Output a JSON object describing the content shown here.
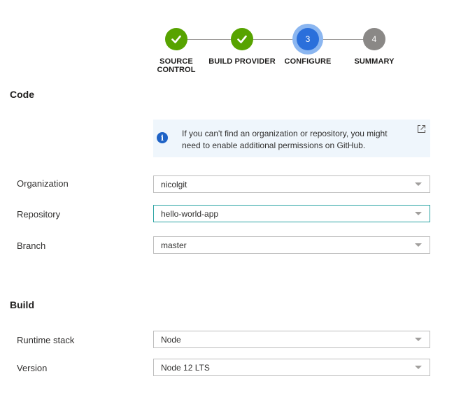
{
  "wizard": {
    "steps": [
      {
        "number": "1",
        "label": "Source control",
        "state": "done"
      },
      {
        "number": "2",
        "label": "Build provider",
        "state": "done"
      },
      {
        "number": "3",
        "label": "Configure",
        "state": "current"
      },
      {
        "number": "4",
        "label": "Summary",
        "state": "todo"
      }
    ]
  },
  "code_section": {
    "title": "Code",
    "info_message": "If you can't find an organization or repository, you might need to enable additional permissions on GitHub.",
    "info_icon": "info-icon",
    "external_link_icon": "open-in-new-window-icon",
    "fields": {
      "organization": {
        "label": "Organization",
        "value": "nicolgit"
      },
      "repository": {
        "label": "Repository",
        "value": "hello-world-app"
      },
      "branch": {
        "label": "Branch",
        "value": "master"
      }
    }
  },
  "build_section": {
    "title": "Build",
    "fields": {
      "runtime_stack": {
        "label": "Runtime stack",
        "value": "Node"
      },
      "version": {
        "label": "Version",
        "value": "Node 12 LTS"
      }
    }
  },
  "colors": {
    "step_done": "#57a300",
    "step_current": "#2a6fdb",
    "step_current_ring": "#8bb6f0",
    "step_todo": "#8a8886",
    "info_background": "#eff6fc",
    "focused_border": "#2aa3a3"
  }
}
